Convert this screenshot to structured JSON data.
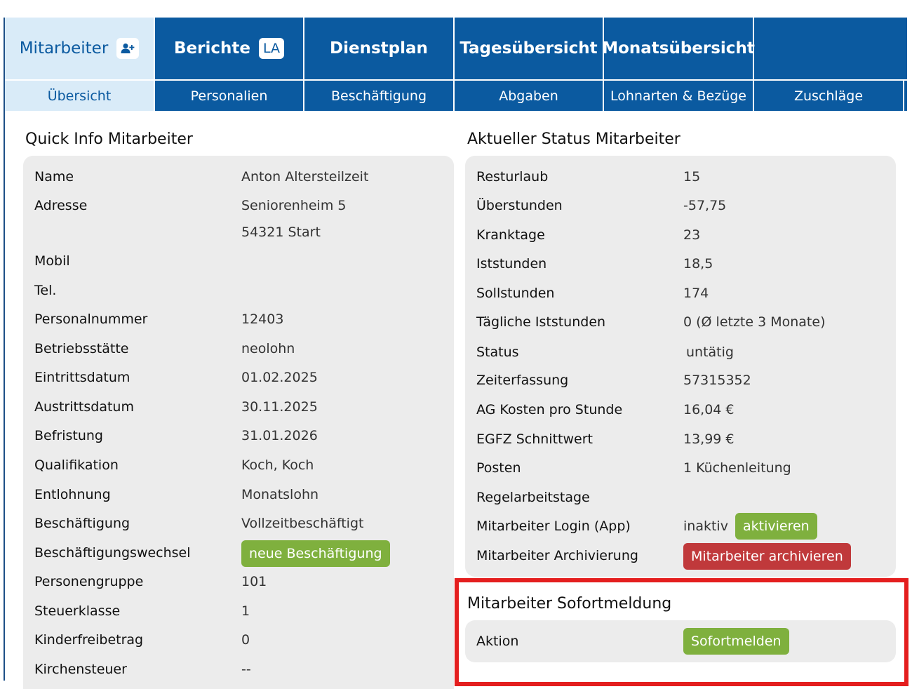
{
  "colors": {
    "nav_blue": "#0b5aa0",
    "active_tab": "#d9ebf8",
    "button_green": "#7fb03e",
    "button_red": "#c0393b",
    "highlight": "#e41e1e",
    "panel": "#ececec"
  },
  "nav": {
    "main_tabs": [
      {
        "label": "Mitarbeiter",
        "icon": "add-user-icon",
        "active": true
      },
      {
        "label": "Berichte",
        "badge": "LA"
      },
      {
        "label": "Dienstplan"
      },
      {
        "label": "Tagesübersicht"
      },
      {
        "label": "Monatsübersicht"
      },
      {
        "label": ""
      }
    ],
    "sub_tabs": [
      {
        "label": "Übersicht",
        "active": true
      },
      {
        "label": "Personalien"
      },
      {
        "label": "Beschäftigung"
      },
      {
        "label": "Abgaben"
      },
      {
        "label": "Lohnarten & Bezüge"
      },
      {
        "label": "Zuschläge"
      }
    ]
  },
  "quick_info": {
    "title": "Quick Info Mitarbeiter",
    "rows": [
      {
        "label": "Name",
        "value": "Anton Altersteilzeit"
      },
      {
        "label": "Adresse",
        "value": "Seniorenheim 5"
      },
      {
        "label": "",
        "value": "54321 Start"
      },
      {
        "label": "Mobil",
        "value": ""
      },
      {
        "label": "Tel.",
        "value": ""
      },
      {
        "label": "Personalnummer",
        "value": "12403"
      },
      {
        "label": "Betriebsstätte",
        "value": "neolohn"
      },
      {
        "label": "Eintrittsdatum",
        "value": "01.02.2025"
      },
      {
        "label": "Austrittsdatum",
        "value": "30.11.2025"
      },
      {
        "label": "Befristung",
        "value": "31.01.2026"
      },
      {
        "label": "Qualifikation",
        "value": "Koch, Koch"
      },
      {
        "label": "Entlohnung",
        "value": "Monatslohn"
      },
      {
        "label": "Beschäftigung",
        "value": "Vollzeitbeschäftigt"
      },
      {
        "label": "Beschäftigungswechsel",
        "value": ""
      },
      {
        "label": "Personengruppe",
        "value": "101"
      },
      {
        "label": "Steuerklasse",
        "value": "1"
      },
      {
        "label": "Kinderfreibetrag",
        "value": "0"
      },
      {
        "label": "Kirchensteuer",
        "value": "--"
      }
    ],
    "new_employment_button": "neue Beschäftigung"
  },
  "status": {
    "title": "Aktueller Status Mitarbeiter",
    "rows": [
      {
        "label": "Resturlaub",
        "value": "15"
      },
      {
        "label": "Überstunden",
        "value": "-57,75"
      },
      {
        "label": "Kranktage",
        "value": "23"
      },
      {
        "label": "Iststunden",
        "value": "18,5"
      },
      {
        "label": "Sollstunden",
        "value": "174"
      },
      {
        "label": "Tägliche Iststunden",
        "value": "0 (Ø letzte 3 Monate)"
      },
      {
        "label": "Status",
        "value": "untätig"
      },
      {
        "label": "Zeiterfassung",
        "value": "57315352"
      },
      {
        "label": "AG Kosten pro Stunde",
        "value": "16,04 €"
      },
      {
        "label": "EGFZ Schnittwert",
        "value": "13,99 €"
      },
      {
        "label": "Posten",
        "value": "1 Küchenleitung"
      },
      {
        "label": "Regelarbeitstage",
        "value": ""
      },
      {
        "label": "Mitarbeiter Login (App)",
        "value": "inaktiv"
      },
      {
        "label": "Mitarbeiter Archivierung",
        "value": ""
      }
    ],
    "activate_button": "aktivieren",
    "archive_button": "Mitarbeiter archivieren"
  },
  "immediate": {
    "title": "Mitarbeiter Sofortmeldung",
    "label": "Aktion",
    "button": "Sofortmelden"
  }
}
